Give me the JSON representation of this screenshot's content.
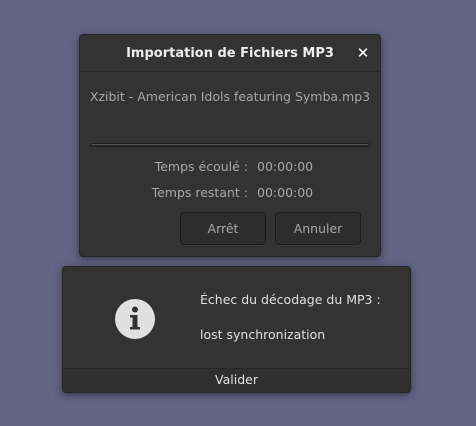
{
  "import_dialog": {
    "title": "Importation de Fichiers MP3",
    "close_glyph": "✕",
    "filename": "Xzibit - American Idols featuring Symba.mp3",
    "progress_fraction": 0,
    "elapsed_label": "Temps écoulé :",
    "elapsed_value": "00:00:00",
    "remaining_label": "Temps restant :",
    "remaining_value": "00:00:00",
    "stop_label": "Arrêt",
    "cancel_label": "Annuler"
  },
  "error_dialog": {
    "icon": "info-icon",
    "message_line1": "Échec du décodage du MP3 :",
    "message_line2": "lost synchronization",
    "ok_label": "Valider"
  }
}
